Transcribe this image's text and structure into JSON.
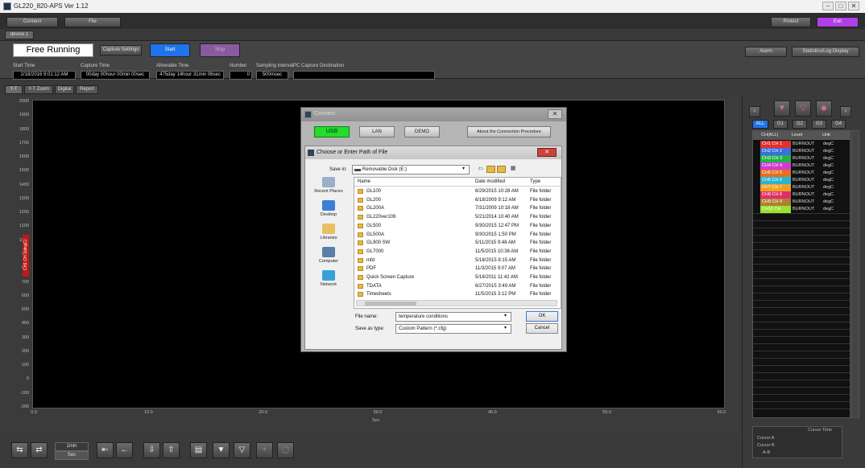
{
  "window": {
    "title": "GL220_820-APS Ver 1.12",
    "minimize": "−",
    "maximize": "□",
    "close": "✕"
  },
  "toolbar": {
    "connect": "Connect",
    "file": "File",
    "protect": "Protect",
    "exit": "Exit"
  },
  "device_tab": "device 1",
  "status": {
    "mode": "Free Running",
    "capture_settings": "Capture Settings",
    "start": "Start",
    "stop": "Stop",
    "alarm": "Alarm",
    "stats": "Statistics/Log Display"
  },
  "info": {
    "start_time_label": "Start Time",
    "start_time": "2/18/2016 9:01:12 AM",
    "capture_time_label": "Capture Time",
    "capture_time": "00day 00hour 00min 00sec",
    "allowable_label": "Allowable Time",
    "allowable": "475day 14hour 31min 06sec",
    "number_label": "Number",
    "number": "0",
    "interval_label": "Sampling interval",
    "interval": "500msec",
    "dest_label": "PC Capture Destination",
    "dest": ""
  },
  "view_tabs": [
    "Y-T",
    "Y-T Zoom",
    "Digital",
    "Report"
  ],
  "chart": {
    "y_ticks": [
      "2000",
      "1900",
      "1800",
      "1700",
      "1600",
      "1500",
      "1400",
      "1300",
      "1200",
      "1100",
      "1000",
      "900",
      "800",
      "700",
      "600",
      "500",
      "400",
      "300",
      "200",
      "100",
      "0",
      "-100",
      "-200"
    ],
    "x_ticks": [
      "0.0",
      "10.0",
      "20.0",
      "30.0",
      "40.0",
      "50.0",
      "60.0"
    ],
    "x_unit": "Sec",
    "y_label": "CH1 CH 1(degC)"
  },
  "bottom": {
    "time_value": "1min",
    "time_unit": "Sec"
  },
  "side": {
    "groups": [
      "ALL",
      "G1",
      "G2",
      "G3",
      "G4"
    ],
    "headers": [
      "CH(ALL)",
      "Level",
      "Unit"
    ],
    "channels": [
      {
        "name": "CH1 CH 1",
        "level": "BURNOUT",
        "unit": "degC",
        "color": "#e03030"
      },
      {
        "name": "CH2 CH 2",
        "level": "BURNOUT",
        "unit": "degC",
        "color": "#3a6ee0"
      },
      {
        "name": "CH3 CH 3",
        "level": "BURNOUT",
        "unit": "degC",
        "color": "#22b24a"
      },
      {
        "name": "CH4 CH 4",
        "level": "BURNOUT",
        "unit": "degC",
        "color": "#d23ad2"
      },
      {
        "name": "CH5 CH 5",
        "level": "BURNOUT",
        "unit": "degC",
        "color": "#e8701e"
      },
      {
        "name": "CH6 CH 6",
        "level": "BURNOUT",
        "unit": "degC",
        "color": "#2ab4d4"
      },
      {
        "name": "CH7 CH 7",
        "level": "BURNOUT",
        "unit": "degC",
        "color": "#f0a020"
      },
      {
        "name": "CH8 CH 8",
        "level": "BURNOUT",
        "unit": "degC",
        "color": "#e0306a"
      },
      {
        "name": "CH9 CH 9",
        "level": "BURNOUT",
        "unit": "degC",
        "color": "#b08030"
      },
      {
        "name": "CH10 CH",
        "level": "BURNOUT",
        "unit": "degC",
        "color": "#9ae030"
      }
    ],
    "cursor_time": "Cursor Time",
    "cursor_a": "Cursor A",
    "cursor_b": "Cursor B",
    "cursor_ab": "A-B"
  },
  "conn_dialog": {
    "title": "Connect",
    "usb": "USB",
    "lan": "LAN",
    "demo": "DEMO",
    "about": "About the Connection Procedure"
  },
  "file_dialog": {
    "title": "Choose or Enter Path of File",
    "save_in_label": "Save in:",
    "save_in": "Removable Disk (E:)",
    "places": [
      "Recent Places",
      "Desktop",
      "Libraries",
      "Computer",
      "Network"
    ],
    "columns": [
      "Name",
      "Date modified",
      "Type"
    ],
    "files": [
      {
        "name": "GL100",
        "date": "6/29/2015 10:28 AM",
        "type": "File folder"
      },
      {
        "name": "GL200",
        "date": "6/18/2009 9:12 AM",
        "type": "File folder"
      },
      {
        "name": "GL200A",
        "date": "7/31/2009 10:18 AM",
        "type": "File folder"
      },
      {
        "name": "GL220ver109",
        "date": "5/21/2014 10:40 AM",
        "type": "File folder"
      },
      {
        "name": "GL500",
        "date": "9/30/2015 12:47 PM",
        "type": "File folder"
      },
      {
        "name": "GL500A",
        "date": "9/30/2015 1:50 PM",
        "type": "File folder"
      },
      {
        "name": "GL900 SW",
        "date": "5/11/2015 9:48 AM",
        "type": "File folder"
      },
      {
        "name": "GL7000",
        "date": "11/5/2015 10:36 AM",
        "type": "File folder"
      },
      {
        "name": "mfd",
        "date": "5/18/2015 9:15 AM",
        "type": "File folder"
      },
      {
        "name": "PDF",
        "date": "11/3/2015 9:07 AM",
        "type": "File folder"
      },
      {
        "name": "Quick Screen Capture",
        "date": "5/16/2011 11:42 AM",
        "type": "File folder"
      },
      {
        "name": "TDATA",
        "date": "6/27/2015 3:49 AM",
        "type": "File folder"
      },
      {
        "name": "Timesheets",
        "date": "11/5/2015 3:12 PM",
        "type": "File folder"
      }
    ],
    "file_name_label": "File name:",
    "file_name": "temperature conditions",
    "save_type_label": "Save as type:",
    "save_type": "Custom Pattern (*.cfg)",
    "ok": "OK",
    "cancel": "Cancel"
  }
}
